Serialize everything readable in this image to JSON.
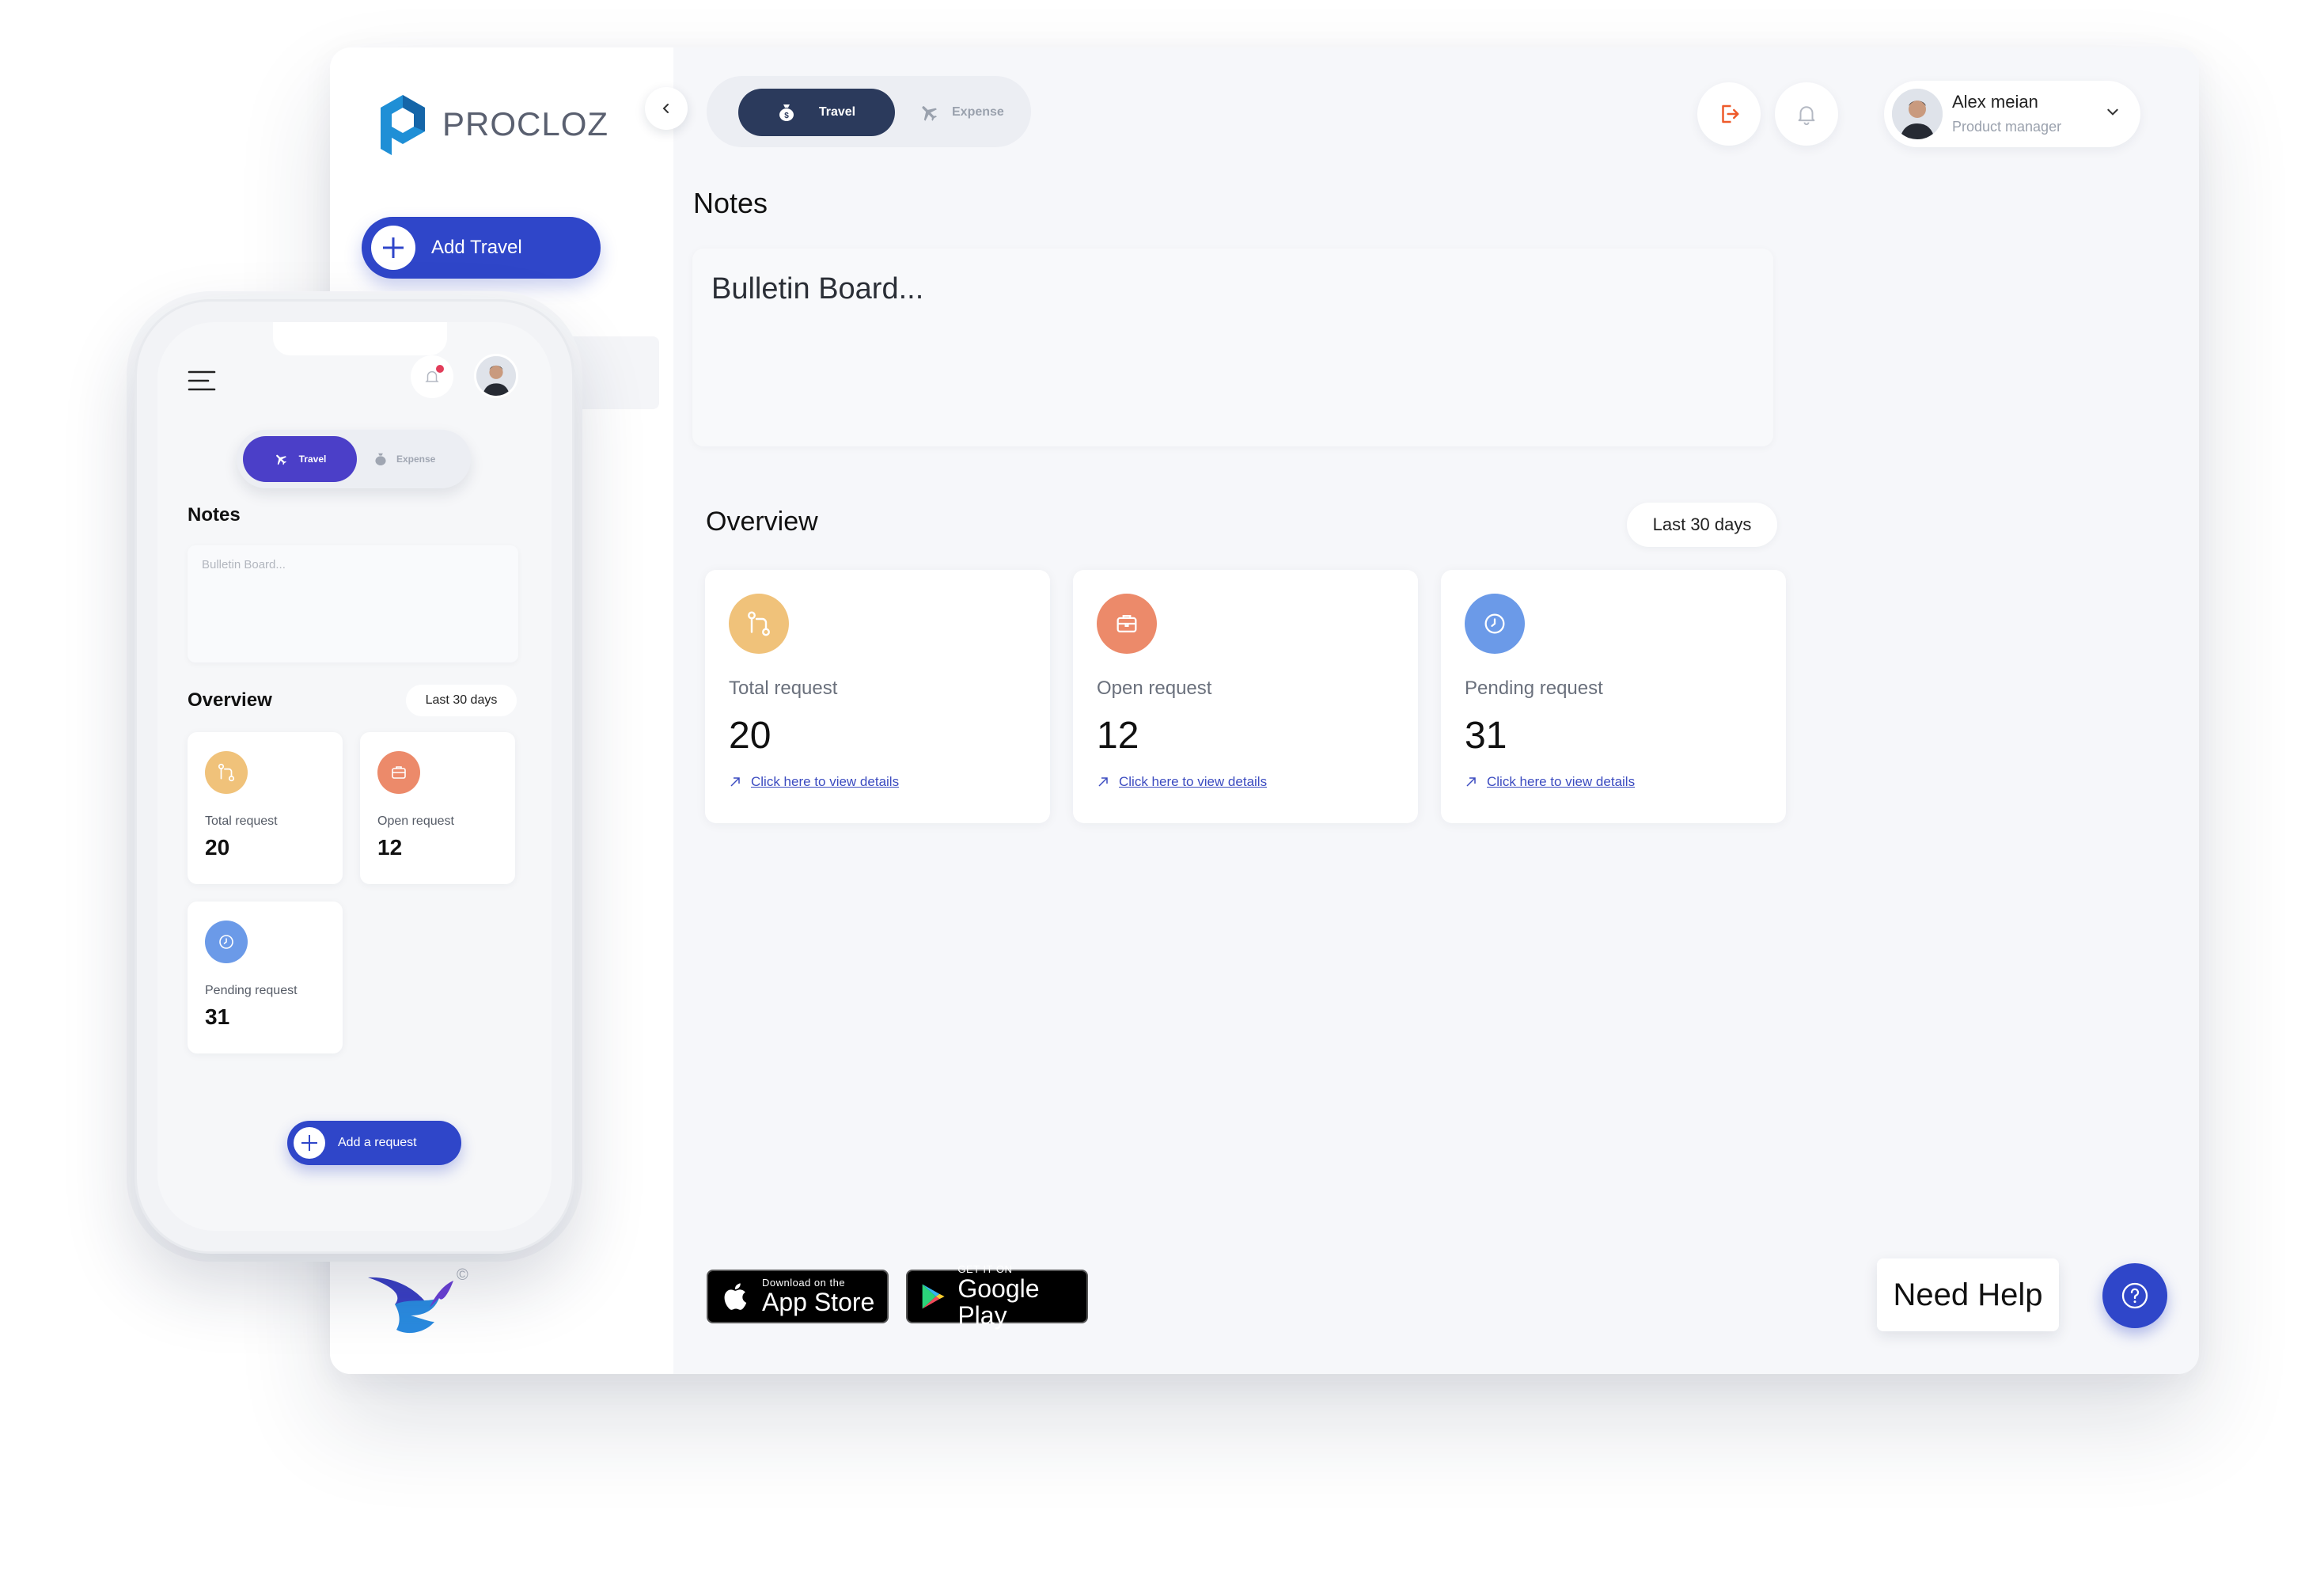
{
  "brand": {
    "name": "PROCLOZ",
    "copyright_mark": "©"
  },
  "sidebar": {
    "add_travel_label": "Add Travel"
  },
  "header": {
    "toggle": {
      "active": "Travel",
      "inactive": "Expense"
    },
    "user": {
      "name": "Alex meian",
      "role": "Product manager"
    }
  },
  "notes": {
    "title": "Notes",
    "placeholder": "Bulletin Board..."
  },
  "overview": {
    "title": "Overview",
    "range": "Last 30 days",
    "link_text": "Click here to view details",
    "cards": [
      {
        "label": "Total request",
        "value": "20",
        "color": "#f0c27a",
        "icon": "git-pull-icon"
      },
      {
        "label": "Open request",
        "value": "12",
        "color": "#ec8a6a",
        "icon": "briefcase-icon"
      },
      {
        "label": "Pending request",
        "value": "31",
        "color": "#6b9ae8",
        "icon": "clock-icon"
      }
    ]
  },
  "stores": {
    "apple": {
      "small": "Download on the",
      "big": "App Store"
    },
    "google": {
      "small": "GET IT ON",
      "big": "Google Play"
    }
  },
  "help": {
    "label": "Need Help"
  },
  "mobile": {
    "toggle": {
      "active": "Travel",
      "inactive": "Expense"
    },
    "notes_title": "Notes",
    "notes_placeholder": "Bulletin Board...",
    "overview_title": "Overview",
    "range": "Last 30 days",
    "cards": [
      {
        "label": "Total request",
        "value": "20"
      },
      {
        "label": "Open request",
        "value": "12"
      },
      {
        "label": "Pending request",
        "value": "31"
      }
    ],
    "add_request_label": "Add a request"
  },
  "colors": {
    "primary": "#2f46c9",
    "dark_toggle": "#2b3a5c",
    "mobile_toggle": "#4b3fc8",
    "logout": "#ee5a2a"
  }
}
